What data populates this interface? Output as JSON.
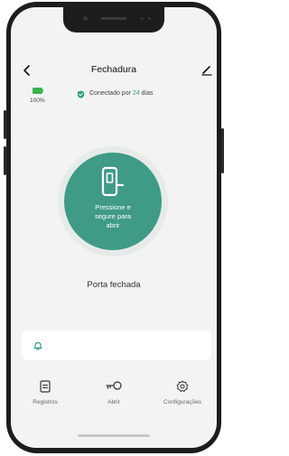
{
  "header": {
    "title": "Fechadura",
    "back_icon": "chevron-left-icon",
    "edit_icon": "pencil-icon"
  },
  "status": {
    "battery_percent": "100%",
    "battery_color": "#3bb34a",
    "connection_prefix": "Conectado por",
    "connection_days": "24",
    "connection_suffix": "dias",
    "accent": "#2f9e84"
  },
  "unlock": {
    "label": "Pressione e\nsegure para\nabrir",
    "button_color": "#3f9b86",
    "icon": "door-icon"
  },
  "door_status": "Porta fechada",
  "alert": {
    "icon": "bell-icon"
  },
  "tabs": [
    {
      "label": "Registros",
      "icon": "records-icon"
    },
    {
      "label": "Abrir",
      "icon": "key-icon"
    },
    {
      "label": "Configurações",
      "icon": "gear-icon"
    }
  ]
}
